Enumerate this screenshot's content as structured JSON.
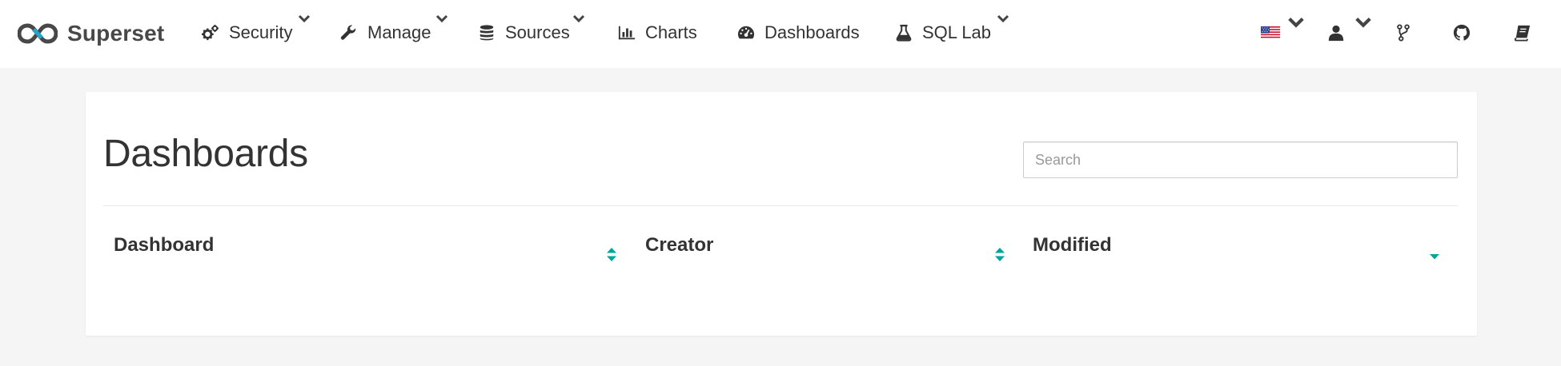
{
  "brand": {
    "name": "Superset",
    "accent": "#20a7c9",
    "logo_color": "#484848"
  },
  "nav": {
    "items": [
      {
        "label": "Security",
        "icon": "gears-icon",
        "dropdown": true
      },
      {
        "label": "Manage",
        "icon": "wrench-icon",
        "dropdown": true
      },
      {
        "label": "Sources",
        "icon": "database-icon",
        "dropdown": true
      },
      {
        "label": "Charts",
        "icon": "bar-chart-icon",
        "dropdown": false
      },
      {
        "label": "Dashboards",
        "icon": "dashboard-gauge-icon",
        "dropdown": false
      },
      {
        "label": "SQL Lab",
        "icon": "flask-icon",
        "dropdown": true
      }
    ],
    "right_icons": [
      {
        "icon": "us-flag-icon",
        "dropdown": true
      },
      {
        "icon": "user-icon",
        "dropdown": true
      },
      {
        "icon": "code-fork-icon",
        "dropdown": false
      },
      {
        "icon": "github-icon",
        "dropdown": false
      },
      {
        "icon": "book-icon",
        "dropdown": false
      }
    ]
  },
  "page": {
    "title": "Dashboards",
    "search": {
      "placeholder": "Search",
      "value": ""
    }
  },
  "table": {
    "columns": [
      {
        "label": "Dashboard",
        "sort": "both"
      },
      {
        "label": "Creator",
        "sort": "both"
      },
      {
        "label": "Modified",
        "sort": "desc"
      }
    ],
    "rows": []
  },
  "colors": {
    "navbar_bg": "#ffffff",
    "page_bg": "#f5f5f5",
    "sort_teal": "#00a699",
    "text": "#333333"
  }
}
